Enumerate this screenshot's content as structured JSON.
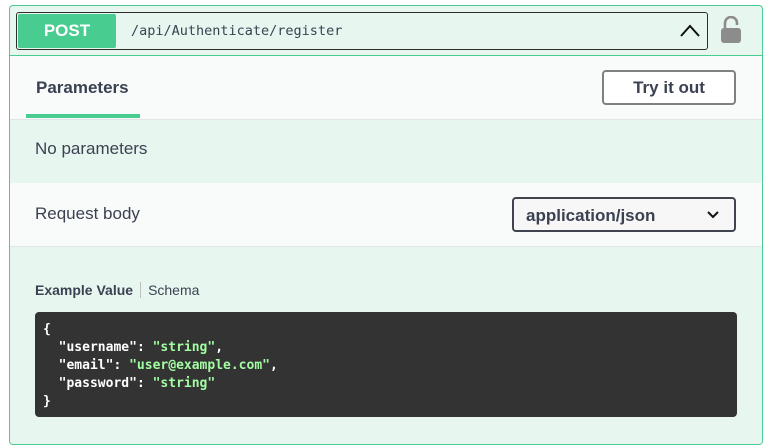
{
  "operation": {
    "method": "POST",
    "path": "/api/Authenticate/register"
  },
  "tabs": {
    "parameters_label": "Parameters",
    "try_it_out_label": "Try it out"
  },
  "parameters": {
    "empty_text": "No parameters"
  },
  "request_body": {
    "label": "Request body",
    "content_type": "application/json"
  },
  "example": {
    "example_value_tab": "Example Value",
    "schema_tab": "Schema",
    "code": {
      "open_brace": "{",
      "close_brace": "}",
      "fields": [
        {
          "key": "\"username\"",
          "value": "\"string\"",
          "trail": ","
        },
        {
          "key": "\"email\"",
          "value": "\"user@example.com\"",
          "trail": ","
        },
        {
          "key": "\"password\"",
          "value": "\"string\"",
          "trail": ""
        }
      ]
    }
  },
  "colors": {
    "post_green": "#49cc90",
    "panel_bg": "#e8f6f0",
    "code_bg": "#333333",
    "code_string": "#a2fca2"
  },
  "icons": {
    "collapse": "chevron-up-icon",
    "lock": "lock-open-icon",
    "dropdown": "chevron-down-icon"
  }
}
